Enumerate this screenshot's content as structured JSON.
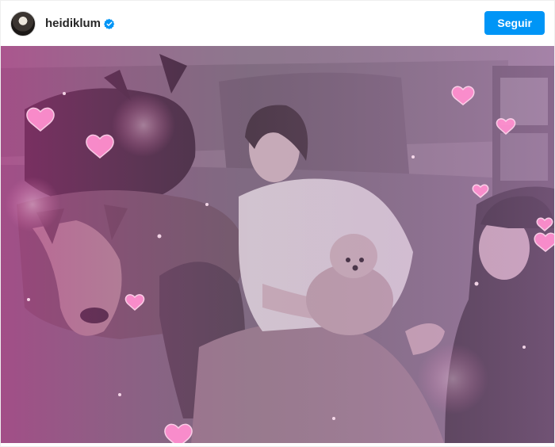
{
  "header": {
    "username": "heidiklum",
    "follow_label": "Seguir",
    "avatar_icon": "profile-avatar",
    "verified_icon": "verified-badge-icon",
    "accent_color": "#0095f6"
  },
  "post": {
    "image_subject": "photo",
    "overlay_icon": "heart-icon"
  }
}
